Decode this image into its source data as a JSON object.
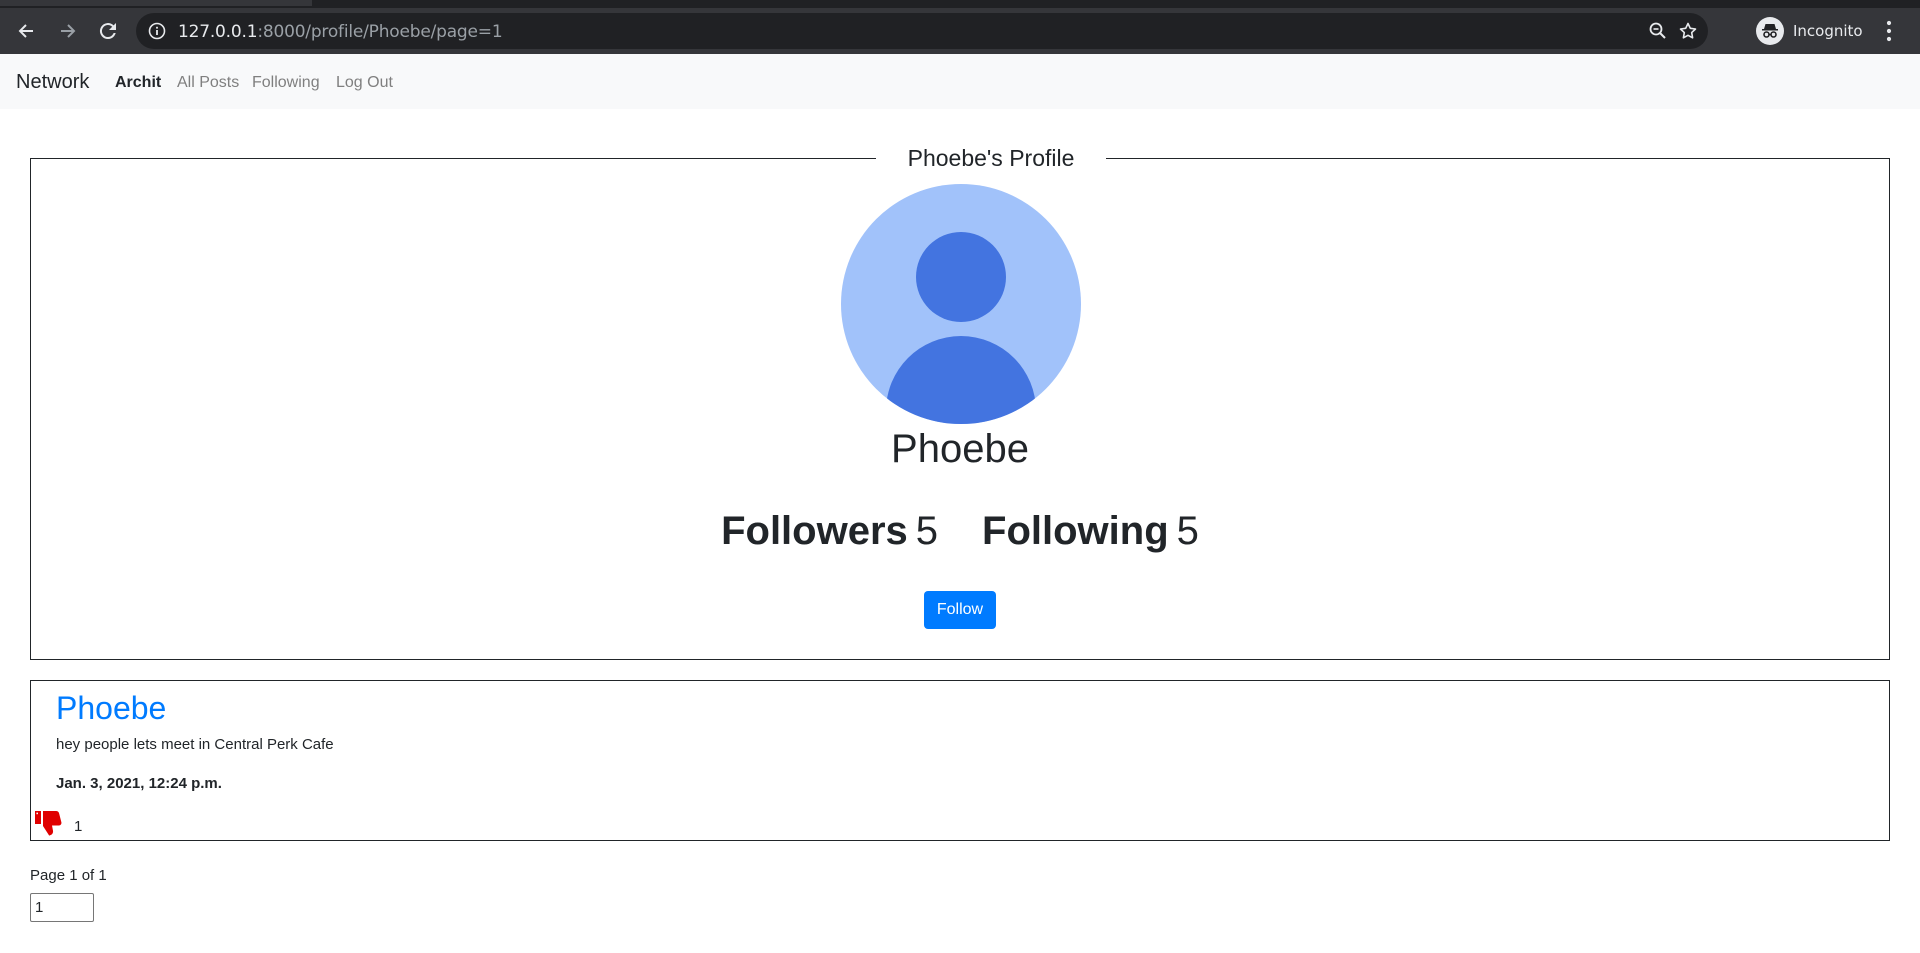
{
  "browser": {
    "url_host": "127.0.0.1",
    "url_rest": ":8000/profile/Phoebe/page=1",
    "profile_label": "Incognito",
    "icons": [
      "back-arrow-icon",
      "forward-arrow-icon",
      "reload-icon",
      "info-icon",
      "zoom-icon",
      "star-icon",
      "incognito-icon",
      "kebab-menu-icon"
    ]
  },
  "navbar": {
    "brand": "Network",
    "user": "Archit",
    "links": [
      "All Posts",
      "Following",
      "Log Out"
    ]
  },
  "profile": {
    "legend": "Phoebe's Profile",
    "name": "Phoebe",
    "followers_label": "Followers",
    "followers_count": "5",
    "following_label": "Following",
    "following_count": "5",
    "follow_button": "Follow",
    "avatar_colors": {
      "background": "#a1c2fa",
      "figure": "#4374e0"
    }
  },
  "post": {
    "author": "Phoebe",
    "content": "hey people lets meet in Central Perk Cafe",
    "timestamp": "Jan. 3, 2021, 12:24 p.m.",
    "like_count": "1",
    "like_icon": "thumbs-down-icon",
    "like_color": "#e00000"
  },
  "pagination": {
    "info": "Page 1 of 1",
    "input_value": "1"
  },
  "colors": {
    "accent": "#007bff",
    "navbar_bg": "#f8f9fa",
    "chrome_bg": "#35363a"
  }
}
